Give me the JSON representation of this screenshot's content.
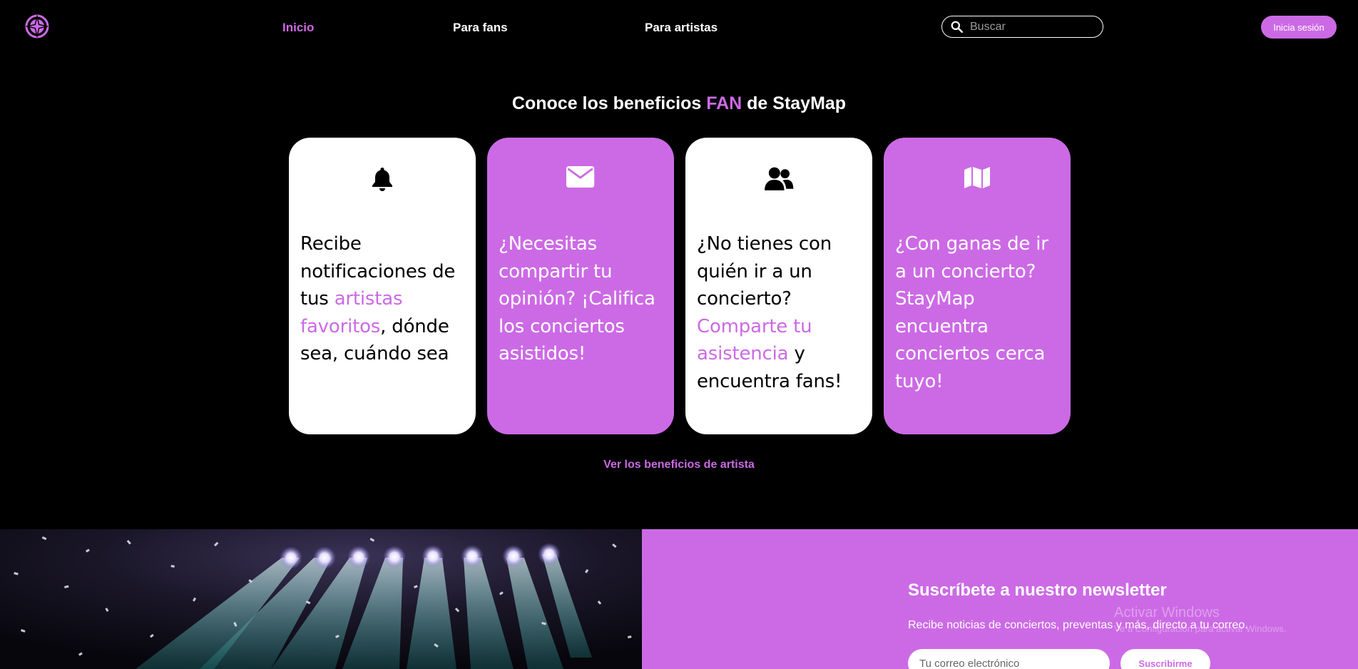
{
  "nav": {
    "links": [
      "Inicio",
      "Para fans",
      "Para artistas"
    ],
    "search_placeholder": "Buscar",
    "login_label": "Inicia sesión"
  },
  "benefits": {
    "title_pre": "Conoce los beneficios ",
    "title_accent": "FAN",
    "title_post": " de StayMap",
    "cards": [
      {
        "icon": "bell-icon",
        "style": "white",
        "text_1": "Recibe notificaciones de tus ",
        "highlight": "artistas favoritos",
        "text_2": ", dónde sea, cuándo sea"
      },
      {
        "icon": "envelope-icon",
        "style": "purple",
        "text_1": "¿Necesitas compartir tu opinión? ¡Califica los conciertos asistidos!",
        "highlight": "",
        "text_2": ""
      },
      {
        "icon": "users-icon",
        "style": "white",
        "text_1": "¿No tienes con quién ir a un concierto? ",
        "highlight": "Comparte tu asistencia",
        "text_2": " y encuentra fans!"
      },
      {
        "icon": "map-icon",
        "style": "purple",
        "text_1": "¿Con ganas de ir a un concierto? StayMap encuentra conciertos cerca tuyo!",
        "highlight": "",
        "text_2": ""
      }
    ],
    "artist_link": "Ver los beneficios de artista"
  },
  "newsletter": {
    "title": "Suscríbete a nuestro newsletter",
    "subtitle": "Recibe noticias de conciertos, preventas y más, directo a tu correo.",
    "email_placeholder": "Tu correo electrónico",
    "button_label": "Suscribirme"
  },
  "watermark": {
    "line1": "Activar Windows",
    "line2": "Ve a Configuración para activar Windows."
  },
  "colors": {
    "accent": "#cc6ae5",
    "background": "#000000",
    "card_white": "#ffffff"
  }
}
